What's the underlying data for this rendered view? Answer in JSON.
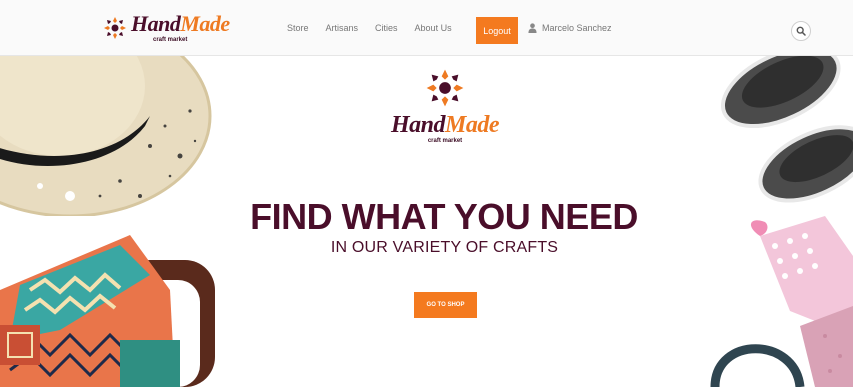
{
  "brand": {
    "name_part1": "Hand",
    "name_part2": "Made",
    "tagline": "craft market"
  },
  "nav": {
    "links": [
      "Store",
      "Artisans",
      "Cities",
      "About Us"
    ],
    "logout_label": "Logout",
    "user_name": "Marcelo Sanchez"
  },
  "hero": {
    "logo_part1": "Hand",
    "logo_part2": "Made",
    "logo_tagline": "craft market",
    "headline": "FIND WHAT YOU NEED",
    "subheadline": "IN OUR VARIETY OF CRAFTS",
    "cta_label": "GO TO SHOP"
  },
  "icons": {
    "search": "search-icon",
    "user": "user-icon",
    "logo": "logo-mark-icon"
  },
  "colors": {
    "brand_dark": "#4a0e2a",
    "brand_orange": "#f47a1f"
  }
}
